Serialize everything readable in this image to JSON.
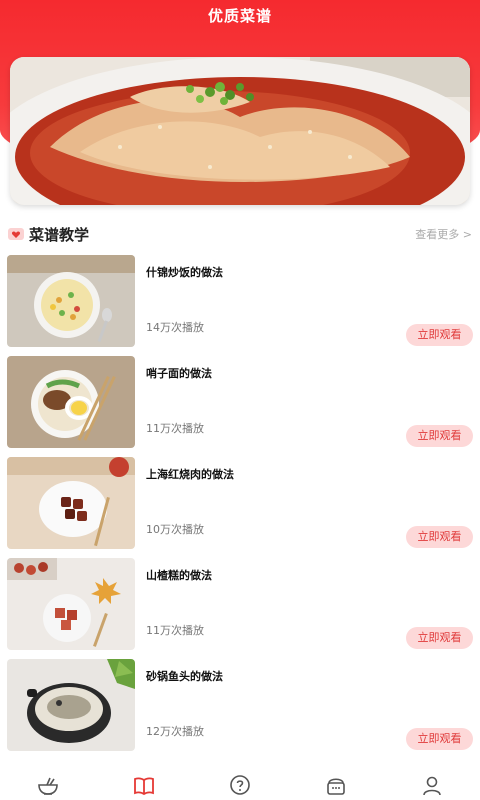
{
  "header": {
    "title": "优质菜谱"
  },
  "banner": {
    "image": "spicy-chicken-dish"
  },
  "section": {
    "title": "菜谱教学",
    "more": "查看更多 >",
    "icon": "heart-icon"
  },
  "recipes": [
    {
      "name": "什锦炒饭的做法",
      "plays": "14万次播放",
      "button": "立即观看",
      "thumb": "fried-rice"
    },
    {
      "name": "哨子面的做法",
      "plays": "11万次播放",
      "button": "立即观看",
      "thumb": "noodles"
    },
    {
      "name": "上海红烧肉的做法",
      "plays": "10万次播放",
      "button": "立即观看",
      "thumb": "braised-pork"
    },
    {
      "name": "山楂糕的做法",
      "plays": "11万次播放",
      "button": "立即观看",
      "thumb": "hawthorn-cake"
    },
    {
      "name": "砂锅鱼头的做法",
      "plays": "12万次播放",
      "button": "立即观看",
      "thumb": "fish-head-pot"
    }
  ],
  "nav": [
    {
      "icon": "bowl-icon",
      "active": false
    },
    {
      "icon": "book-icon",
      "active": true
    },
    {
      "icon": "question-icon",
      "active": false
    },
    {
      "icon": "food-box-icon",
      "active": false
    },
    {
      "icon": "user-icon",
      "active": false
    }
  ],
  "colors": {
    "primary": "#f52a2f",
    "button_bg": "#fdd8d8",
    "button_text": "#e03a3a",
    "inactive_icon": "#555555"
  }
}
